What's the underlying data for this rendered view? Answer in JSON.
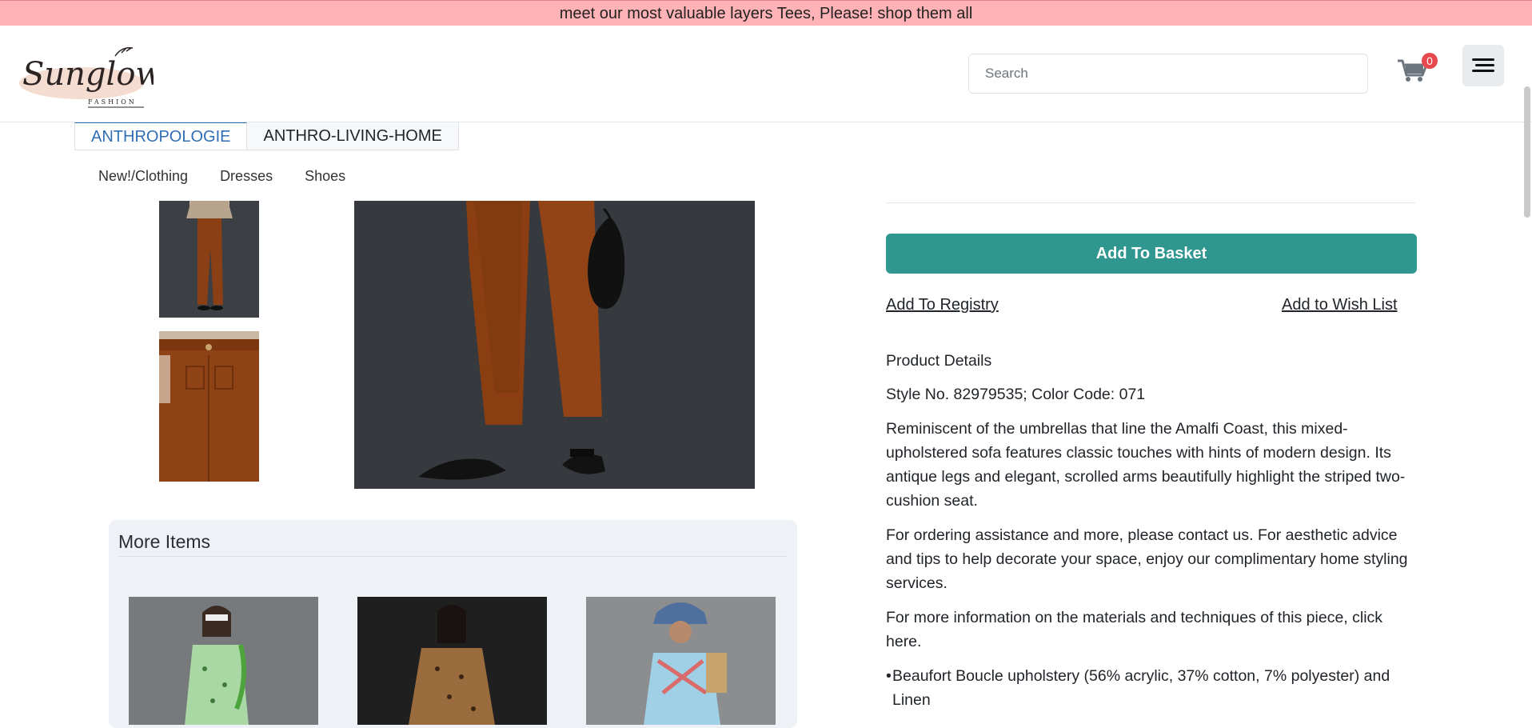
{
  "promo": {
    "text": "meet our most valuable layers Tees, Please! shop them all"
  },
  "header": {
    "logo": {
      "name": "Sunglow",
      "sub": "FASHION"
    },
    "search": {
      "placeholder": "Search",
      "value": ""
    },
    "cart": {
      "count": "0"
    }
  },
  "tabs": [
    {
      "label": "ANTHROPOLOGIE",
      "active": true
    },
    {
      "label": "ANTHRO-LIVING-HOME",
      "active": false
    }
  ],
  "subnav": [
    "New!/Clothing",
    "Dresses",
    "Shoes"
  ],
  "product": {
    "add_to_basket": "Add To Basket",
    "add_to_registry": "Add To Registry",
    "add_to_wishlist": "Add to Wish List",
    "details_heading": "Product Details",
    "style_line": "Style No. 82979535; Color Code: 071",
    "description": "Reminiscent of the umbrellas that line the Amalfi Coast, this mixed-upholstered sofa features classic touches with hints of modern design. Its antique legs and elegant, scrolled arms beautifully highlight the striped two-cushion seat.",
    "assistance": "For ordering assistance and more, please contact us. For aesthetic advice and tips to help decorate your space, enjoy our complimentary home styling services.",
    "more_info": "For more information on the materials and techniques of this piece, click here.",
    "bullets": [
      "Beaufort Boucle upholstery (56% acrylic, 37% cotton, 7% polyester) and Linen"
    ]
  },
  "more_items": {
    "title": "More Items"
  },
  "colors": {
    "promo": "#ffb3b6",
    "accent": "#2f9690",
    "tab_active": "#2f6db5",
    "badge": "#e5484d"
  }
}
